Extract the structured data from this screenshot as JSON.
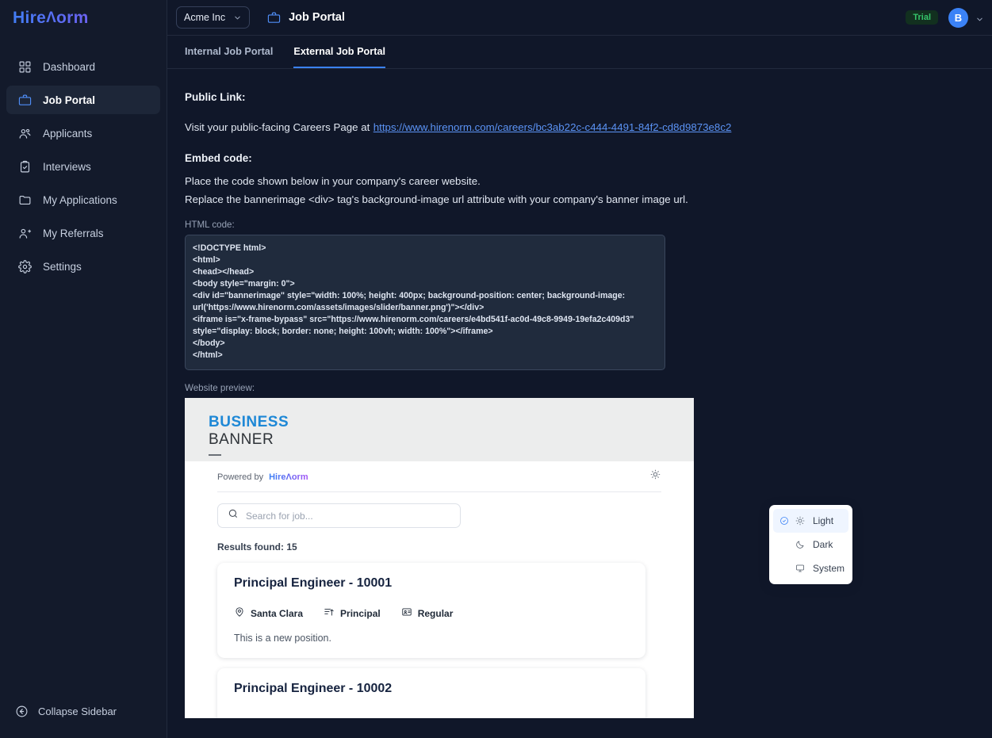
{
  "brand": {
    "name_part1": "Hire",
    "name_peak": "Λ",
    "name_part2": "orm"
  },
  "sidebar": {
    "items": [
      {
        "label": "Dashboard",
        "icon": "grid-icon"
      },
      {
        "label": "Job Portal",
        "icon": "briefcase-icon"
      },
      {
        "label": "Applicants",
        "icon": "users-icon"
      },
      {
        "label": "Interviews",
        "icon": "clipboard-check-icon"
      },
      {
        "label": "My Applications",
        "icon": "folder-icon"
      },
      {
        "label": "My Referrals",
        "icon": "user-plus-icon"
      },
      {
        "label": "Settings",
        "icon": "gear-icon"
      }
    ],
    "collapse_label": "Collapse Sidebar"
  },
  "topbar": {
    "org": "Acme Inc",
    "page_title": "Job Portal",
    "trial_badge": "Trial",
    "avatar_initial": "B"
  },
  "tabs": [
    {
      "label": "Internal Job Portal",
      "active": false
    },
    {
      "label": "External Job Portal",
      "active": true
    }
  ],
  "public_link": {
    "heading": "Public Link:",
    "text": "Visit your public-facing Careers Page at",
    "url": "https://www.hirenorm.com/careers/bc3ab22c-c444-4491-84f2-cd8d9873e8c2"
  },
  "embed": {
    "heading": "Embed code:",
    "line1": "Place the code shown below in your company's career website.",
    "line2": "Replace the bannerimage <div> tag's background-image url attribute with your company's banner image url.",
    "html_code_label": "HTML code:",
    "html_code": "<!DOCTYPE html>\n<html>\n<head></head>\n<body style=\"margin: 0\">\n<div id=\"bannerimage\" style=\"width: 100%; height: 400px; background-position: center; background-image: url('https://www.hirenorm.com/assets/images/slider/banner.png')\"></div>\n<iframe is=\"x-frame-bypass\" src=\"https://www.hirenorm.com/careers/e4bd541f-ac0d-49c8-9949-19efa2c409d3\" style=\"display: block; border: none; height: 100vh; width: 100%\"></iframe>\n</body>\n</html>",
    "preview_label": "Website preview:"
  },
  "preview": {
    "banner_line1": "BUSINESS",
    "banner_line2": "BANNER",
    "powered_by": "Powered by",
    "powered_brand": "HireΛorm",
    "search_placeholder": "Search for job...",
    "search_value": "",
    "results_text": "Results found: 15",
    "jobs": [
      {
        "title": "Principal Engineer - 10001",
        "location": "Santa Clara",
        "level": "Principal",
        "type": "Regular",
        "description": "This is a new position."
      },
      {
        "title": "Principal Engineer - 10002",
        "location": "",
        "level": "",
        "type": "",
        "description": ""
      }
    ]
  },
  "theme_menu": {
    "options": [
      {
        "label": "Light",
        "icon": "sun-icon",
        "selected": true
      },
      {
        "label": "Dark",
        "icon": "moon-icon",
        "selected": false
      },
      {
        "label": "System",
        "icon": "monitor-icon",
        "selected": false
      }
    ]
  },
  "colors": {
    "sidebar_bg": "#131a2b",
    "main_bg": "#101729",
    "accent": "#3b82f6",
    "code_bg": "#202b3d",
    "trial_green": "#35c46a",
    "link": "#5b93f5"
  }
}
